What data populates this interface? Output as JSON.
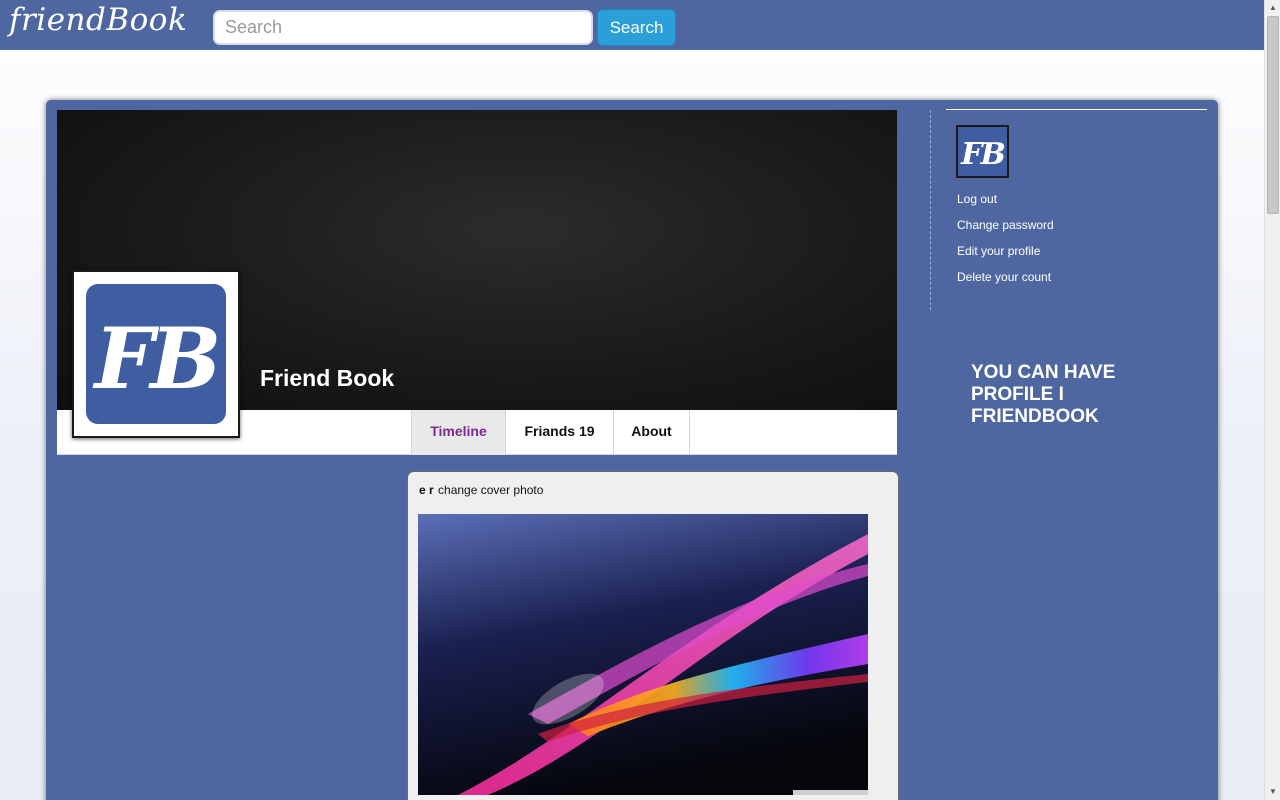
{
  "header": {
    "logo": "friendBook",
    "search_placeholder": "Search",
    "search_button": "Search"
  },
  "profile": {
    "name": "Friend Book",
    "photo_letters": "FB"
  },
  "tabs": [
    {
      "label": "Timeline",
      "active": true
    },
    {
      "label": "Friands 19",
      "active": false
    },
    {
      "label": "About",
      "active": false
    }
  ],
  "post": {
    "author": "e r",
    "action": "change cover photo"
  },
  "sidebar": {
    "avatar_letters": "FB",
    "links": [
      "Log out",
      "Change password",
      "Edit your profile",
      "Delete your count"
    ],
    "promo": "YOU CAN HAVE PROFILE I FRIENDBOOK"
  },
  "colors": {
    "brand": "#4e67a0",
    "button": "#2a9fd8",
    "active_tab_text": "#7b2a8e"
  }
}
